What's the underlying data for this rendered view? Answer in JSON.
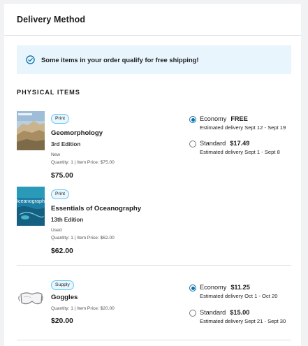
{
  "header": {
    "title": "Delivery Method"
  },
  "banner": {
    "message": "Some items in your order qualify for free shipping!"
  },
  "section": {
    "title": "PHYSICAL ITEMS"
  },
  "items": [
    {
      "badge": "Print",
      "name": "Geomorphology",
      "edition": "3rd Edition",
      "condition": "New",
      "quantity": "Quantity: 1  |  Item Price: $75.00",
      "price": "$75.00"
    },
    {
      "badge": "Print",
      "name": "Essentials of Oceanography",
      "edition": "13th Edition",
      "condition": "Used",
      "quantity": "Quantity: 1  |  Item Price: $62.00",
      "price": "$62.00",
      "cover_text": "Oceanography"
    },
    {
      "badge": "Supply",
      "name": "Goggles",
      "quantity": "Quantity: 1  |  Item Price: $20.00",
      "price": "$20.00"
    }
  ],
  "shipping_groups": [
    {
      "options": [
        {
          "label": "Economy",
          "price": "FREE",
          "estimate": "Estimated delivery Sept 12 - Sept 19",
          "selected": true
        },
        {
          "label": "Standard",
          "price": "$17.49",
          "estimate": "Estimated delivery Sept 1 - Sept 8",
          "selected": false
        }
      ]
    },
    {
      "options": [
        {
          "label": "Economy",
          "price": "$11.25",
          "estimate": "Estimated delivery Oct 1 - Oct 20",
          "selected": true
        },
        {
          "label": "Standard",
          "price": "$15.00",
          "estimate": "Estimated delivery Sept 21 - Sept 30",
          "selected": false
        }
      ]
    }
  ],
  "colors": {
    "accent": "#0a71a8",
    "banner_bg": "#e8f5fd",
    "badge_border": "#66c7f2"
  }
}
